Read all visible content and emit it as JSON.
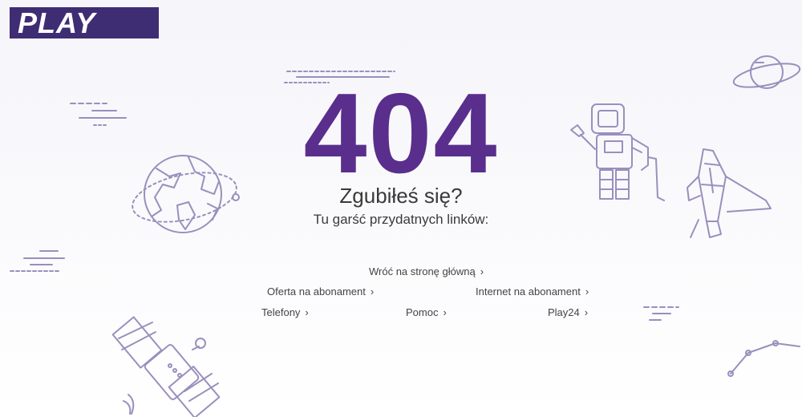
{
  "logo": {
    "text": "PLAY"
  },
  "error": {
    "code": "404",
    "title": "Zgubiłeś się?",
    "subtitle": "Tu garść przydatnych linków:"
  },
  "links": {
    "home": "Wróć na stronę główną",
    "subscription_offer": "Oferta na abonament",
    "internet_subscription": "Internet na abonament",
    "phones": "Telefony",
    "help": "Pomoc",
    "play24": "Play24"
  },
  "chevron": "›",
  "colors": {
    "brand": "#3f2d74",
    "accent": "#5a2e8c",
    "illustration": "#9a8fbd"
  }
}
